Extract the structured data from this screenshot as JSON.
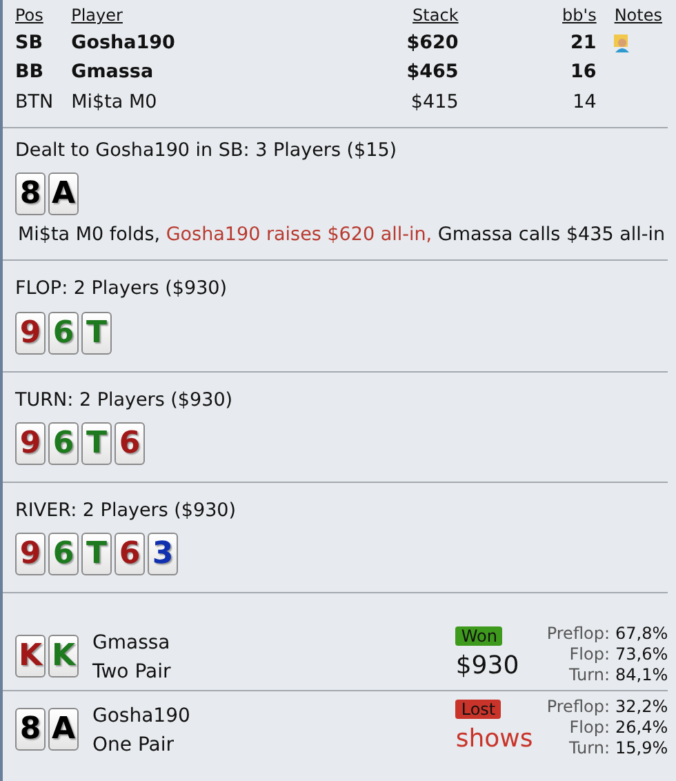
{
  "players": {
    "columns": [
      "Pos",
      "Player",
      "Stack",
      "bb's",
      "Notes"
    ],
    "rows": [
      {
        "pos": "SB",
        "name": "Gosha190",
        "stack": "$620",
        "bbs": "21",
        "bold": true,
        "has_note": true
      },
      {
        "pos": "BB",
        "name": "Gmassa",
        "stack": "$465",
        "bbs": "16",
        "bold": true,
        "has_note": false
      },
      {
        "pos": "BTN",
        "name": "Mi$ta M0",
        "stack": "$415",
        "bbs": "14",
        "bold": false,
        "has_note": false
      }
    ]
  },
  "preflop": {
    "title": "Dealt to Gosha190 in SB: 3 Players ($15)",
    "cards": [
      {
        "rank": "8",
        "color": "#000000"
      },
      {
        "rank": "A",
        "color": "#000000"
      }
    ],
    "actions": [
      {
        "text": "Mi$ta M0 folds,",
        "hero": false
      },
      {
        "text": "Gosha190 raises $620 all-in,",
        "hero": true
      },
      {
        "text": "Gmassa calls $435 all-in",
        "hero": false
      }
    ]
  },
  "streets": [
    {
      "title": "FLOP: 2 Players ($930)",
      "cards": [
        {
          "rank": "9",
          "color": "#a01818"
        },
        {
          "rank": "6",
          "color": "#1e7a1e"
        },
        {
          "rank": "T",
          "color": "#1e7a1e"
        }
      ]
    },
    {
      "title": "TURN: 2 Players ($930)",
      "cards": [
        {
          "rank": "9",
          "color": "#a01818"
        },
        {
          "rank": "6",
          "color": "#1e7a1e"
        },
        {
          "rank": "T",
          "color": "#1e7a1e"
        },
        {
          "rank": "6",
          "color": "#a01818"
        }
      ]
    },
    {
      "title": "RIVER: 2 Players ($930)",
      "cards": [
        {
          "rank": "9",
          "color": "#a01818"
        },
        {
          "rank": "6",
          "color": "#1e7a1e"
        },
        {
          "rank": "T",
          "color": "#1e7a1e"
        },
        {
          "rank": "6",
          "color": "#a01818"
        },
        {
          "rank": "3",
          "color": "#1030b0"
        }
      ]
    }
  ],
  "results": [
    {
      "cards": [
        {
          "rank": "K",
          "color": "#a01818"
        },
        {
          "rank": "K",
          "color": "#1e7a1e"
        }
      ],
      "name": "Gmassa",
      "hand": "Two Pair",
      "outcome": "Won",
      "won": true,
      "amount": "$930",
      "equity": [
        {
          "label": "Preflop:",
          "value": "67,8%"
        },
        {
          "label": "Flop:",
          "value": "73,6%"
        },
        {
          "label": "Turn:",
          "value": "84,1%"
        }
      ]
    },
    {
      "cards": [
        {
          "rank": "8",
          "color": "#000000"
        },
        {
          "rank": "A",
          "color": "#000000"
        }
      ],
      "name": "Gosha190",
      "hand": "One Pair",
      "outcome": "Lost",
      "won": false,
      "amount": "shows",
      "equity": [
        {
          "label": "Preflop:",
          "value": "32,2%"
        },
        {
          "label": "Flop:",
          "value": "26,4%"
        },
        {
          "label": "Turn:",
          "value": "15,9%"
        }
      ]
    }
  ]
}
